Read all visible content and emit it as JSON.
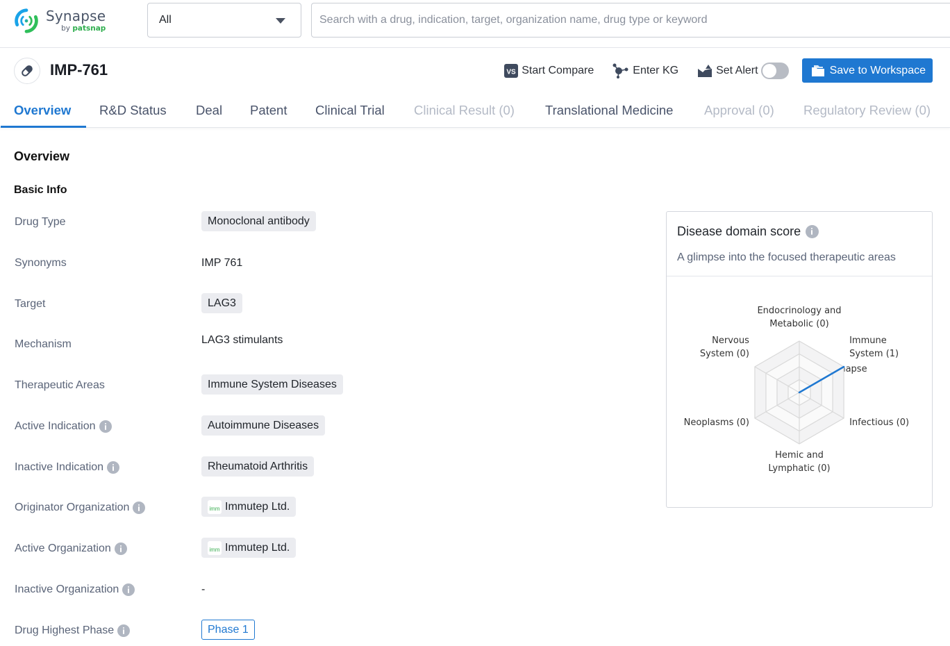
{
  "app": {
    "name": "Synapse",
    "by": "by",
    "brand": "patsnap"
  },
  "search": {
    "scope_selected": "All",
    "placeholder": "Search with a drug, indication, target, organization name, drug type or keyword",
    "value": ""
  },
  "header": {
    "drug_name": "IMP-761",
    "icon": "pill-icon",
    "actions": {
      "compare_label": "Start Compare",
      "kg_label": "Enter KG",
      "alert_label": "Set Alert",
      "alert_enabled": false,
      "save_label": "Save to Workspace"
    }
  },
  "tabs": [
    {
      "label": "Overview",
      "state": "active"
    },
    {
      "label": "R&D Status",
      "state": "normal"
    },
    {
      "label": "Deal",
      "state": "normal"
    },
    {
      "label": "Patent",
      "state": "normal"
    },
    {
      "label": "Clinical Trial",
      "state": "normal"
    },
    {
      "label": "Clinical Result (0)",
      "state": "disabled"
    },
    {
      "label": "Translational Medicine",
      "state": "normal"
    },
    {
      "label": "Approval (0)",
      "state": "disabled"
    },
    {
      "label": "Regulatory Review (0)",
      "state": "disabled"
    }
  ],
  "overview": {
    "heading": "Overview",
    "section": "Basic Info",
    "fields": [
      {
        "label": "Drug Type",
        "value": "Monoclonal antibody",
        "kind": "tag",
        "info": false
      },
      {
        "label": "Synonyms",
        "value": "IMP 761",
        "kind": "text",
        "info": false
      },
      {
        "label": "Target",
        "value": "LAG3",
        "kind": "tag",
        "info": false
      },
      {
        "label": "Mechanism",
        "value": "LAG3 stimulants",
        "kind": "text",
        "info": false
      },
      {
        "label": "Therapeutic Areas",
        "value": "Immune System Diseases",
        "kind": "tag",
        "info": false
      },
      {
        "label": "Active Indication",
        "value": "Autoimmune Diseases",
        "kind": "tag",
        "info": true
      },
      {
        "label": "Inactive Indication",
        "value": "Rheumatoid Arthritis",
        "kind": "tag",
        "info": true
      },
      {
        "label": "Originator Organization",
        "value": "Immutep Ltd.",
        "kind": "org",
        "org_logo": "imm",
        "info": true
      },
      {
        "label": "Active Organization",
        "value": "Immutep Ltd.",
        "kind": "org",
        "org_logo": "imm",
        "info": true
      },
      {
        "label": "Inactive Organization",
        "value": "-",
        "kind": "text",
        "info": true
      },
      {
        "label": "Drug Highest Phase",
        "value": "Phase 1",
        "kind": "phase",
        "info": true
      }
    ]
  },
  "disease_card": {
    "title": "Disease domain score",
    "subtitle": "A glimpse into the focused therapeutic areas"
  },
  "chart_data": {
    "type": "radar",
    "title": "Disease domain score",
    "axes": [
      {
        "label_lines": [
          "Endocrinology and",
          "Metabolic (0)"
        ],
        "name": "Endocrinology and Metabolic",
        "value": 0
      },
      {
        "label_lines": [
          "Immune",
          "System (1)"
        ],
        "name": "Immune System",
        "value": 1
      },
      {
        "label_lines": [
          "Infectious (0)"
        ],
        "name": "Infectious",
        "value": 0
      },
      {
        "label_lines": [
          "Hemic and",
          "Lymphatic (0)"
        ],
        "name": "Hemic and Lymphatic",
        "value": 0
      },
      {
        "label_lines": [
          "Neoplasms (0)"
        ],
        "name": "Neoplasms",
        "value": 0
      },
      {
        "label_lines": [
          "Nervous",
          "System (0)"
        ],
        "name": "Nervous System",
        "value": 0
      }
    ],
    "max": 1,
    "rings": 4,
    "series_color": "#1f78d1",
    "watermark": "Synapse by patsnap"
  },
  "colors": {
    "accent": "#1f78d1",
    "brand_green": "#2fae4e"
  }
}
